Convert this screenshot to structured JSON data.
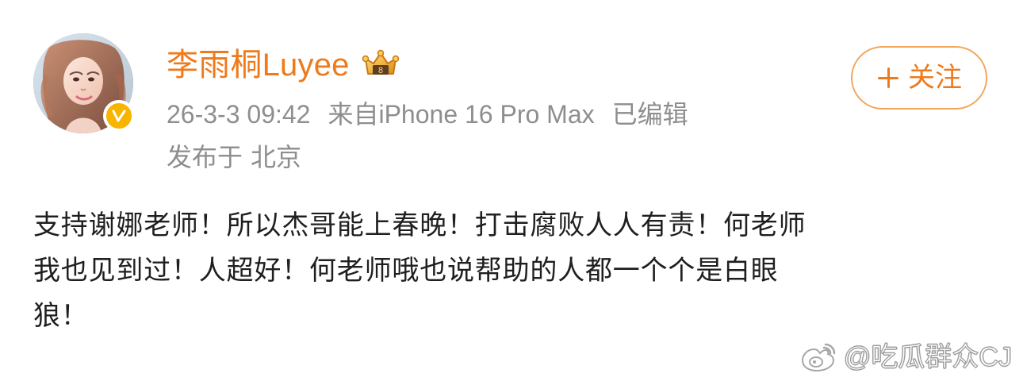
{
  "post": {
    "author": {
      "name": "李雨桐Luyee",
      "avatar_icon": "avatar-photo",
      "verified_badge": "verified-v-icon",
      "crown_badge": "crown-icon"
    },
    "meta": {
      "timestamp": "26-3-3 09:42",
      "source": "来自iPhone 16 Pro Max",
      "edited": "已编辑"
    },
    "location": {
      "prefix": "发布于",
      "city": "北京"
    },
    "follow_button": {
      "label": "关注",
      "icon": "plus-icon"
    },
    "content_lines": [
      "支持谢娜老师！所以杰哥能上春晚！打击腐败人人有责！何老师",
      "我也见到过！人超好！何老师哦也说帮助的人都一个个是白眼",
      "狼！"
    ],
    "watermark": {
      "icon": "weibo-icon",
      "text": "@吃瓜群众CJ"
    },
    "colors": {
      "accent": "#ef7a1b",
      "meta_gray": "#8e8e8e",
      "body_text": "#1f1f1f",
      "badge_yellow": "#f7b500"
    }
  }
}
